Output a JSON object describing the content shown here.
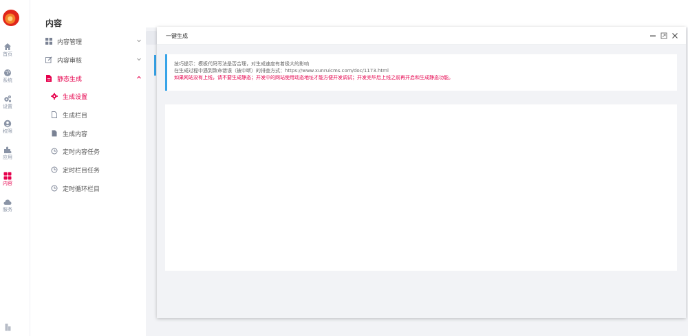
{
  "rail": {
    "items": [
      {
        "label": "首页",
        "icon": "home-icon"
      },
      {
        "label": "系统",
        "icon": "globe-icon"
      },
      {
        "label": "设置",
        "icon": "gears-icon"
      },
      {
        "label": "权限",
        "icon": "user-icon"
      },
      {
        "label": "应用",
        "icon": "puzzle-icon"
      },
      {
        "label": "内容",
        "icon": "grid-icon",
        "active": true
      },
      {
        "label": "服务",
        "icon": "cloud-icon"
      }
    ]
  },
  "submenu": {
    "title": "内容",
    "content_manage": "内容管理",
    "content_review": "内容审核",
    "static_gen": "静态生成",
    "children": [
      "生成设置",
      "生成栏目",
      "生成内容",
      "定时内容任务",
      "定时栏目任务",
      "定时循环栏目"
    ]
  },
  "modal": {
    "title": "一键生成",
    "tip_line1": "技巧提示：模板代码写法是否合理，对生成速度有着极大的影响",
    "tip_line2": "在生成过程中遇到致命错误（被中断）的排查方式：https://www.xunruicms.com/doc/1173.html",
    "tip_line3": "如果网站没有上线，请不要生成静态；开发中的网站使用动态地址才能方便开发调试；开发完毕后上线之前再开启和生成静态功能。"
  },
  "colors": {
    "accent": "#e6004c",
    "info_border": "#38a4e8",
    "rail_text": "#8a94a6"
  }
}
